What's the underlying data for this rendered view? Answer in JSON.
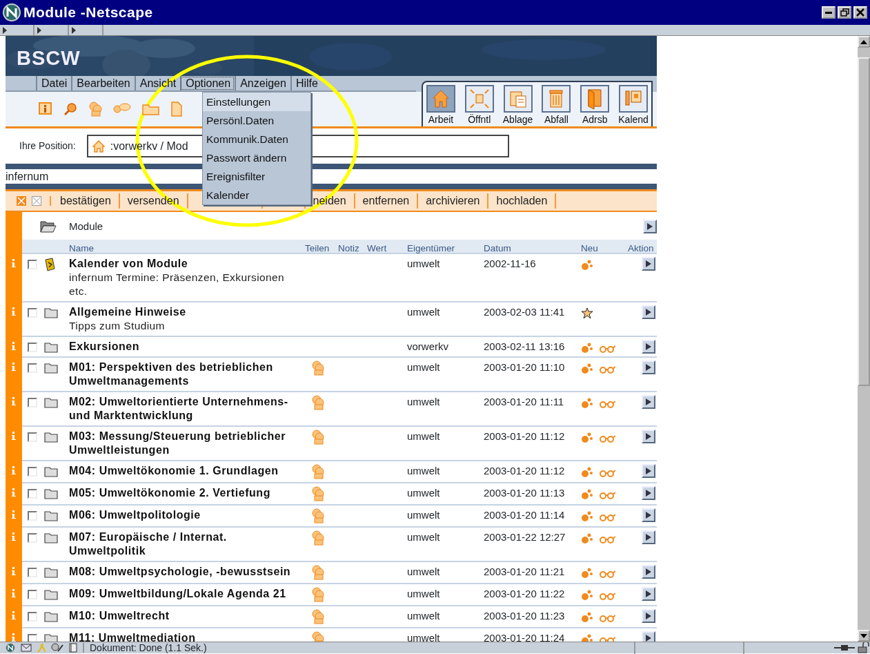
{
  "window": {
    "title": "Module -Netscape"
  },
  "header": {
    "logo": "BSCW"
  },
  "menu_bar": [
    {
      "label": "Datei",
      "open": false
    },
    {
      "label": "Bearbeiten",
      "open": false
    },
    {
      "label": "Ansicht",
      "open": false
    },
    {
      "label": "Optionen",
      "open": true
    },
    {
      "label": "Anzeigen",
      "open": false
    },
    {
      "label": "Hilfe",
      "open": false
    }
  ],
  "options_menu": [
    {
      "label": "Einstellungen",
      "selected": true
    },
    {
      "label": "Persönl.Daten",
      "selected": false
    },
    {
      "label": "Kommunik.Daten",
      "selected": false
    },
    {
      "label": "Passwort ändern",
      "selected": false
    },
    {
      "label": "Ereignisfilter",
      "selected": false
    },
    {
      "label": "Kalender",
      "selected": false
    }
  ],
  "nav_buttons": [
    {
      "label": "Arbeit",
      "kind": "home",
      "selected": true
    },
    {
      "label": "Öffntl",
      "kind": "public",
      "selected": false
    },
    {
      "label": "Ablage",
      "kind": "clipboard",
      "selected": false
    },
    {
      "label": "Abfall",
      "kind": "trash",
      "selected": false
    },
    {
      "label": "Adrsb",
      "kind": "addressbook",
      "selected": false
    },
    {
      "label": "Kalend",
      "kind": "calendar",
      "selected": false
    }
  ],
  "position": {
    "label": "Ihre Position:",
    "path": ":vorwerkv / Mod"
  },
  "workspace": "infernum",
  "actions": [
    {
      "label": "bestätigen",
      "hidden_before": false
    },
    {
      "label": "versenden",
      "hidden_before": false
    },
    {
      "label": "neiden",
      "hidden_before": true
    },
    {
      "label": "entfernen",
      "hidden_before": false
    },
    {
      "label": "archivieren",
      "hidden_before": false
    },
    {
      "label": "hochladen",
      "hidden_before": false
    }
  ],
  "folder": {
    "name": "Module"
  },
  "columns": [
    "Name",
    "Teilen",
    "Notiz",
    "Wert",
    "Eigentümer",
    "Datum",
    "Neu",
    "Aktion"
  ],
  "rows": [
    {
      "name": "Kalender von Module",
      "description": "infernum Termine: Präsenzen, Exkursionen etc.",
      "kind": "calendar",
      "checked": false,
      "shared": false,
      "owner": "umwelt",
      "date": "2002-11-16",
      "new": true,
      "changed": false,
      "seen": false
    },
    {
      "name": "Allgemeine Hinweise",
      "description": "Tipps zum Studium",
      "kind": "folder",
      "checked": false,
      "shared": false,
      "owner": "umwelt",
      "date": "2003-02-03 11:41",
      "new": false,
      "changed": true,
      "seen": false
    },
    {
      "name": "Exkursionen",
      "kind": "folder",
      "checked": false,
      "shared": false,
      "owner": "vorwerkv",
      "date": "2003-02-11 13:16",
      "new": true,
      "changed": false,
      "seen": true
    },
    {
      "name": "M01: Perspektiven des betrieblichen Umweltmanagements",
      "kind": "folder",
      "checked": false,
      "shared": true,
      "owner": "umwelt",
      "date": "2003-01-20 11:10",
      "new": true,
      "changed": false,
      "seen": true
    },
    {
      "name": "M02: Umweltorientierte Unternehmens- und Marktentwicklung",
      "kind": "folder",
      "checked": false,
      "shared": true,
      "owner": "umwelt",
      "date": "2003-01-20 11:11",
      "new": true,
      "changed": false,
      "seen": true
    },
    {
      "name": "M03: Messung/Steuerung betrieblicher Umweltleistungen",
      "kind": "folder",
      "checked": false,
      "shared": true,
      "owner": "umwelt",
      "date": "2003-01-20 11:12",
      "new": true,
      "changed": false,
      "seen": true
    },
    {
      "name": "M04: Umweltökonomie 1. Grundlagen",
      "kind": "folder",
      "checked": false,
      "shared": true,
      "owner": "umwelt",
      "date": "2003-01-20 11:12",
      "new": true,
      "changed": false,
      "seen": true
    },
    {
      "name": "M05: Umweltökonomie 2. Vertiefung",
      "kind": "folder",
      "checked": false,
      "shared": true,
      "owner": "umwelt",
      "date": "2003-01-20 11:13",
      "new": true,
      "changed": false,
      "seen": true
    },
    {
      "name": "M06: Umweltpolitologie",
      "kind": "folder",
      "checked": false,
      "shared": true,
      "owner": "umwelt",
      "date": "2003-01-20 11:14",
      "new": true,
      "changed": false,
      "seen": true
    },
    {
      "name": "M07: Europäische / Internat. Umweltpolitik",
      "kind": "folder",
      "checked": false,
      "shared": true,
      "owner": "umwelt",
      "date": "2003-01-22 12:27",
      "new": true,
      "changed": false,
      "seen": true
    },
    {
      "name": "M08: Umweltpsychologie, -bewusstsein",
      "kind": "folder",
      "checked": false,
      "shared": true,
      "owner": "umwelt",
      "date": "2003-01-20 11:21",
      "new": true,
      "changed": false,
      "seen": true
    },
    {
      "name": "M09: Umweltbildung/Lokale Agenda 21",
      "kind": "folder",
      "checked": false,
      "shared": true,
      "owner": "umwelt",
      "date": "2003-01-20 11:22",
      "new": true,
      "changed": false,
      "seen": true
    },
    {
      "name": "M10: Umweltrecht",
      "kind": "folder",
      "checked": false,
      "shared": true,
      "owner": "umwelt",
      "date": "2003-01-20 11:23",
      "new": true,
      "changed": false,
      "seen": true
    },
    {
      "name": "M11: Umweltmediation",
      "kind": "folder",
      "checked": false,
      "shared": true,
      "owner": "umwelt",
      "date": "2003-01-20 11:24",
      "new": true,
      "changed": false,
      "seen": true
    }
  ],
  "status_bar": {
    "text": "Dokument: Done (1.1 Sek.)"
  }
}
